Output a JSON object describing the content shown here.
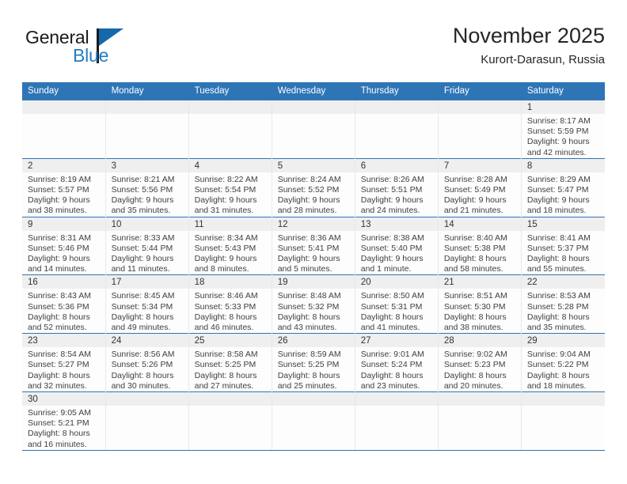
{
  "brand": {
    "name_part1": "General",
    "name_part2": "Blue",
    "flag_icon": "blue-triangle-flag",
    "accent_color": "#1f7cc4"
  },
  "header": {
    "title": "November 2025",
    "location": "Kurort-Darasun, Russia"
  },
  "theme": {
    "header_blue": "#2e75b6",
    "daynum_bg": "#efefef",
    "cell_bg": "#fdfdfd"
  },
  "weekday_headers": [
    "Sunday",
    "Monday",
    "Tuesday",
    "Wednesday",
    "Thursday",
    "Friday",
    "Saturday"
  ],
  "weeks": [
    [
      {
        "day": "",
        "empty": true
      },
      {
        "day": "",
        "empty": true
      },
      {
        "day": "",
        "empty": true
      },
      {
        "day": "",
        "empty": true
      },
      {
        "day": "",
        "empty": true
      },
      {
        "day": "",
        "empty": true
      },
      {
        "day": "1",
        "sunrise": "Sunrise: 8:17 AM",
        "sunset": "Sunset: 5:59 PM",
        "daylight_line1": "Daylight: 9 hours",
        "daylight_line2": "and 42 minutes."
      }
    ],
    [
      {
        "day": "2",
        "sunrise": "Sunrise: 8:19 AM",
        "sunset": "Sunset: 5:57 PM",
        "daylight_line1": "Daylight: 9 hours",
        "daylight_line2": "and 38 minutes."
      },
      {
        "day": "3",
        "sunrise": "Sunrise: 8:21 AM",
        "sunset": "Sunset: 5:56 PM",
        "daylight_line1": "Daylight: 9 hours",
        "daylight_line2": "and 35 minutes."
      },
      {
        "day": "4",
        "sunrise": "Sunrise: 8:22 AM",
        "sunset": "Sunset: 5:54 PM",
        "daylight_line1": "Daylight: 9 hours",
        "daylight_line2": "and 31 minutes."
      },
      {
        "day": "5",
        "sunrise": "Sunrise: 8:24 AM",
        "sunset": "Sunset: 5:52 PM",
        "daylight_line1": "Daylight: 9 hours",
        "daylight_line2": "and 28 minutes."
      },
      {
        "day": "6",
        "sunrise": "Sunrise: 8:26 AM",
        "sunset": "Sunset: 5:51 PM",
        "daylight_line1": "Daylight: 9 hours",
        "daylight_line2": "and 24 minutes."
      },
      {
        "day": "7",
        "sunrise": "Sunrise: 8:28 AM",
        "sunset": "Sunset: 5:49 PM",
        "daylight_line1": "Daylight: 9 hours",
        "daylight_line2": "and 21 minutes."
      },
      {
        "day": "8",
        "sunrise": "Sunrise: 8:29 AM",
        "sunset": "Sunset: 5:47 PM",
        "daylight_line1": "Daylight: 9 hours",
        "daylight_line2": "and 18 minutes."
      }
    ],
    [
      {
        "day": "9",
        "sunrise": "Sunrise: 8:31 AM",
        "sunset": "Sunset: 5:46 PM",
        "daylight_line1": "Daylight: 9 hours",
        "daylight_line2": "and 14 minutes."
      },
      {
        "day": "10",
        "sunrise": "Sunrise: 8:33 AM",
        "sunset": "Sunset: 5:44 PM",
        "daylight_line1": "Daylight: 9 hours",
        "daylight_line2": "and 11 minutes."
      },
      {
        "day": "11",
        "sunrise": "Sunrise: 8:34 AM",
        "sunset": "Sunset: 5:43 PM",
        "daylight_line1": "Daylight: 9 hours",
        "daylight_line2": "and 8 minutes."
      },
      {
        "day": "12",
        "sunrise": "Sunrise: 8:36 AM",
        "sunset": "Sunset: 5:41 PM",
        "daylight_line1": "Daylight: 9 hours",
        "daylight_line2": "and 5 minutes."
      },
      {
        "day": "13",
        "sunrise": "Sunrise: 8:38 AM",
        "sunset": "Sunset: 5:40 PM",
        "daylight_line1": "Daylight: 9 hours",
        "daylight_line2": "and 1 minute."
      },
      {
        "day": "14",
        "sunrise": "Sunrise: 8:40 AM",
        "sunset": "Sunset: 5:38 PM",
        "daylight_line1": "Daylight: 8 hours",
        "daylight_line2": "and 58 minutes."
      },
      {
        "day": "15",
        "sunrise": "Sunrise: 8:41 AM",
        "sunset": "Sunset: 5:37 PM",
        "daylight_line1": "Daylight: 8 hours",
        "daylight_line2": "and 55 minutes."
      }
    ],
    [
      {
        "day": "16",
        "sunrise": "Sunrise: 8:43 AM",
        "sunset": "Sunset: 5:36 PM",
        "daylight_line1": "Daylight: 8 hours",
        "daylight_line2": "and 52 minutes."
      },
      {
        "day": "17",
        "sunrise": "Sunrise: 8:45 AM",
        "sunset": "Sunset: 5:34 PM",
        "daylight_line1": "Daylight: 8 hours",
        "daylight_line2": "and 49 minutes."
      },
      {
        "day": "18",
        "sunrise": "Sunrise: 8:46 AM",
        "sunset": "Sunset: 5:33 PM",
        "daylight_line1": "Daylight: 8 hours",
        "daylight_line2": "and 46 minutes."
      },
      {
        "day": "19",
        "sunrise": "Sunrise: 8:48 AM",
        "sunset": "Sunset: 5:32 PM",
        "daylight_line1": "Daylight: 8 hours",
        "daylight_line2": "and 43 minutes."
      },
      {
        "day": "20",
        "sunrise": "Sunrise: 8:50 AM",
        "sunset": "Sunset: 5:31 PM",
        "daylight_line1": "Daylight: 8 hours",
        "daylight_line2": "and 41 minutes."
      },
      {
        "day": "21",
        "sunrise": "Sunrise: 8:51 AM",
        "sunset": "Sunset: 5:30 PM",
        "daylight_line1": "Daylight: 8 hours",
        "daylight_line2": "and 38 minutes."
      },
      {
        "day": "22",
        "sunrise": "Sunrise: 8:53 AM",
        "sunset": "Sunset: 5:28 PM",
        "daylight_line1": "Daylight: 8 hours",
        "daylight_line2": "and 35 minutes."
      }
    ],
    [
      {
        "day": "23",
        "sunrise": "Sunrise: 8:54 AM",
        "sunset": "Sunset: 5:27 PM",
        "daylight_line1": "Daylight: 8 hours",
        "daylight_line2": "and 32 minutes."
      },
      {
        "day": "24",
        "sunrise": "Sunrise: 8:56 AM",
        "sunset": "Sunset: 5:26 PM",
        "daylight_line1": "Daylight: 8 hours",
        "daylight_line2": "and 30 minutes."
      },
      {
        "day": "25",
        "sunrise": "Sunrise: 8:58 AM",
        "sunset": "Sunset: 5:25 PM",
        "daylight_line1": "Daylight: 8 hours",
        "daylight_line2": "and 27 minutes."
      },
      {
        "day": "26",
        "sunrise": "Sunrise: 8:59 AM",
        "sunset": "Sunset: 5:25 PM",
        "daylight_line1": "Daylight: 8 hours",
        "daylight_line2": "and 25 minutes."
      },
      {
        "day": "27",
        "sunrise": "Sunrise: 9:01 AM",
        "sunset": "Sunset: 5:24 PM",
        "daylight_line1": "Daylight: 8 hours",
        "daylight_line2": "and 23 minutes."
      },
      {
        "day": "28",
        "sunrise": "Sunrise: 9:02 AM",
        "sunset": "Sunset: 5:23 PM",
        "daylight_line1": "Daylight: 8 hours",
        "daylight_line2": "and 20 minutes."
      },
      {
        "day": "29",
        "sunrise": "Sunrise: 9:04 AM",
        "sunset": "Sunset: 5:22 PM",
        "daylight_line1": "Daylight: 8 hours",
        "daylight_line2": "and 18 minutes."
      }
    ],
    [
      {
        "day": "30",
        "sunrise": "Sunrise: 9:05 AM",
        "sunset": "Sunset: 5:21 PM",
        "daylight_line1": "Daylight: 8 hours",
        "daylight_line2": "and 16 minutes."
      },
      {
        "day": "",
        "empty": true
      },
      {
        "day": "",
        "empty": true
      },
      {
        "day": "",
        "empty": true
      },
      {
        "day": "",
        "empty": true
      },
      {
        "day": "",
        "empty": true
      },
      {
        "day": "",
        "empty": true
      }
    ]
  ]
}
